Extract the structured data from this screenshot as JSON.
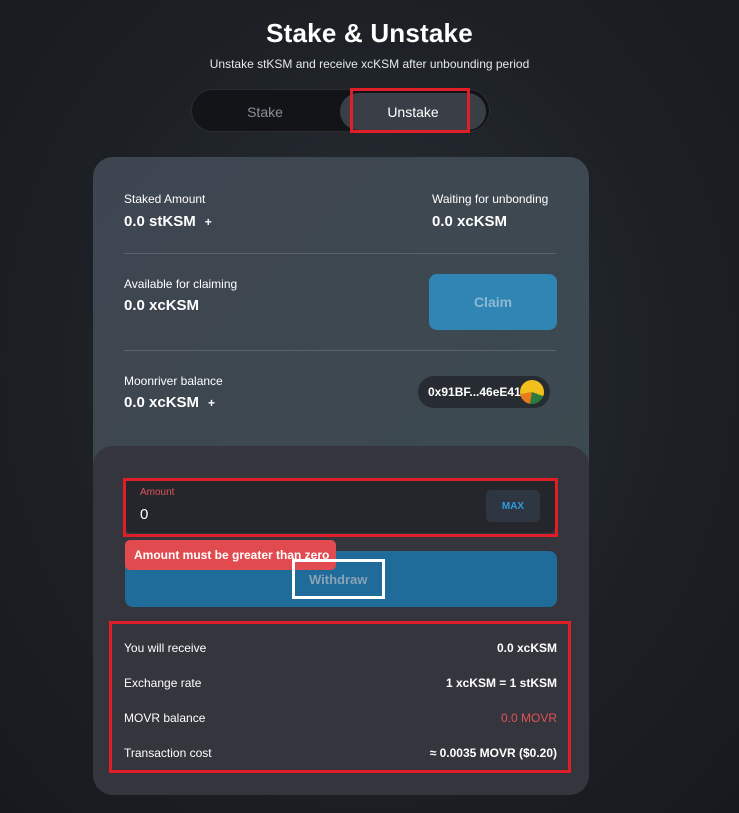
{
  "header": {
    "title": "Stake & Unstake",
    "subtitle": "Unstake stKSM and receive xcKSM after unbounding period"
  },
  "tabs": {
    "stake_label": "Stake",
    "unstake_label": "Unstake",
    "active": "Unstake"
  },
  "balances": {
    "staked_label": "Staked Amount",
    "staked_value": "0.0 stKSM",
    "waiting_label": "Waiting for unbonding",
    "waiting_value": "0.0 xcKSM",
    "available_label": "Available for claiming",
    "available_value": "0.0 xcKSM",
    "claim_label": "Claim",
    "moonriver_label": "Moonriver balance",
    "moonriver_value": "0.0 xcKSM",
    "address": "0x91BF...46eE41"
  },
  "form": {
    "amount_label": "Amount",
    "amount_value": "0",
    "max_label": "MAX",
    "error_text": "Amount must be greater than zero",
    "withdraw_label": "Withdraw"
  },
  "summary": [
    {
      "label": "You will receive",
      "value": "0.0 xcKSM"
    },
    {
      "label": "Exchange rate",
      "value": "1 xcKSM = 1 stKSM"
    },
    {
      "label": "MOVR balance",
      "value": "0.0 MOVR"
    },
    {
      "label": "Transaction cost",
      "value": "≈ 0.0035 MOVR ($0.20)"
    }
  ],
  "colors": {
    "accent_blue": "#2f86b5",
    "error_red": "#e14b50",
    "highlight_red": "#e01e27"
  },
  "icons": {
    "plus": "+"
  }
}
